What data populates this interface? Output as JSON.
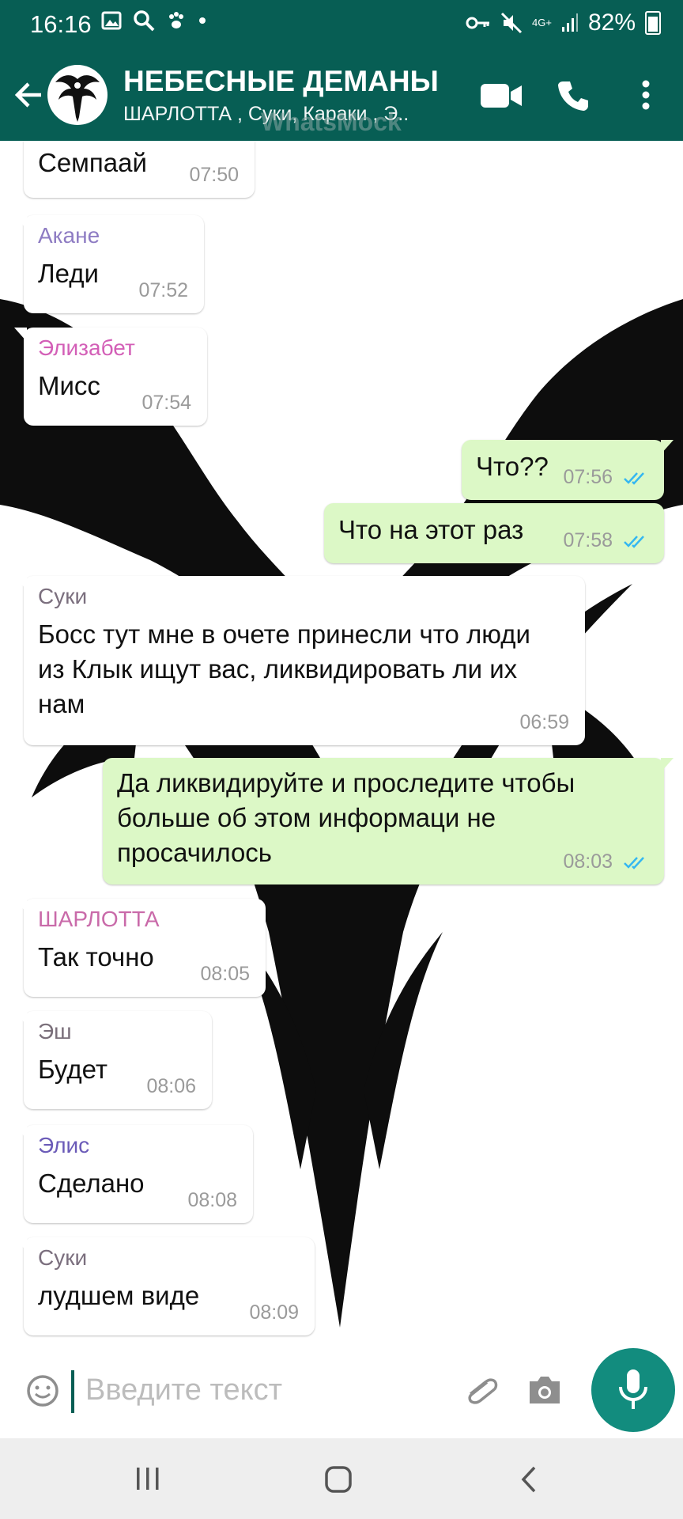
{
  "status_bar": {
    "time": "16:16",
    "network": "4G+",
    "battery": "82%",
    "icons": [
      "image-icon",
      "search-icon",
      "paw-icon",
      "dot-icon",
      "key-icon",
      "mute-icon",
      "signal-icon",
      "battery-icon"
    ]
  },
  "header": {
    "title": "НЕБЕСНЫЕ ДЕМАНЫ",
    "subtitle": "ШАРЛОТТА , Суки, Караки , Э..",
    "watermark": "WhatsMock",
    "icons": [
      "back-arrow-icon",
      "group-avatar",
      "video-call-icon",
      "voice-call-icon",
      "more-options-icon"
    ]
  },
  "messages": [
    {
      "dir": "in",
      "sender": "",
      "text": "Семпаай",
      "time": "07:50"
    },
    {
      "dir": "in",
      "sender": "Акане",
      "sender_color": "#8e7cc3",
      "text": "Леди",
      "time": "07:52"
    },
    {
      "dir": "in",
      "sender": "Элизабет",
      "sender_color": "#d35fb7",
      "text": "Мисс",
      "time": "07:54"
    },
    {
      "dir": "out",
      "text": "Что??",
      "time": "07:56",
      "read": true
    },
    {
      "dir": "out",
      "text": "Что на этот раз",
      "time": "07:58",
      "read": true
    },
    {
      "dir": "in",
      "sender": "Суки",
      "sender_color": "#7b6f7e",
      "text": "Босс тут мне в очете принесли что люди из Клык ищут вас, ликвидировать ли их нам",
      "time": "06:59"
    },
    {
      "dir": "out",
      "text": "Да ликвидируйте и проследите чтобы больше об этом информаци не просачилось",
      "time": "08:03",
      "read": true
    },
    {
      "dir": "in",
      "sender": "ШАРЛОТТА",
      "sender_color": "#c96aa9",
      "text": "Так точно",
      "time": "08:05"
    },
    {
      "dir": "in",
      "sender": "Эш",
      "sender_color": "#7a6f7a",
      "text": "Будет",
      "time": "08:06"
    },
    {
      "dir": "in",
      "sender": "Элис",
      "sender_color": "#6b5bb8",
      "text": "Сделано",
      "time": "08:08"
    },
    {
      "dir": "in",
      "sender": "Суки",
      "sender_color": "#7b6f7e",
      "text": "лудшем виде",
      "time": "08:09"
    }
  ],
  "composer": {
    "placeholder": "Введите текст",
    "icons": [
      "emoji-icon",
      "attach-icon",
      "camera-icon",
      "mic-icon"
    ]
  },
  "nav": {
    "icons": [
      "recent-apps-icon",
      "home-icon",
      "back-icon"
    ]
  },
  "colors": {
    "accent": "#075e54",
    "outgoing_bubble": "#dcf8c6",
    "mic_button": "#128c7e",
    "read_ticks": "#34b7f1"
  }
}
